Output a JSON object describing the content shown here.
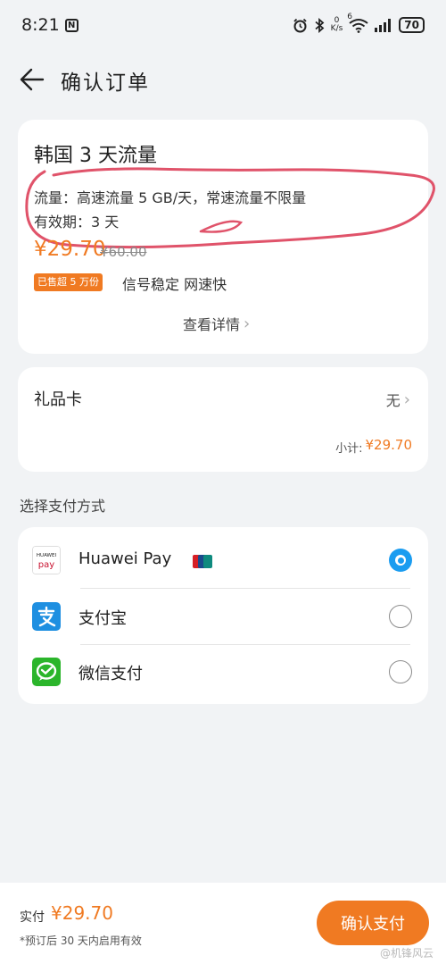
{
  "status_bar": {
    "time": "8:21",
    "notification_badge": "N",
    "network_speed_value": "0",
    "network_speed_unit": "K/s",
    "wifi_label": "6",
    "battery": "70"
  },
  "header": {
    "title": "确认订单"
  },
  "product": {
    "name": "韩国 3 天流量",
    "spec_traffic": "流量：高速流量 5 GB/天，常速流量不限量",
    "spec_validity": "有效期：3 天",
    "price": "¥29.70",
    "original_price": "¥60.00",
    "sold_badge": "已售超 5 万份",
    "tagline": "信号稳定 网速快",
    "details_link": "查看详情"
  },
  "gift_card": {
    "label": "礼品卡",
    "value": "无",
    "subtotal_label": "小计:",
    "subtotal_amount": "¥29.70"
  },
  "payment": {
    "section_title": "选择支付方式",
    "methods": [
      {
        "name": "Huawei Pay",
        "icon": "huawei-pay-icon",
        "selected": true
      },
      {
        "name": "支付宝",
        "icon": "alipay-icon",
        "selected": false
      },
      {
        "name": "微信支付",
        "icon": "wechat-pay-icon",
        "selected": false
      }
    ]
  },
  "bottom": {
    "total_label": "实付",
    "total_amount": "¥29.70",
    "validity_note": "*预订后 30 天内启用有效",
    "confirm_label": "确认支付",
    "watermark": "@机锋风云"
  },
  "colors": {
    "accent": "#f07a22",
    "radio_selected": "#1a9cf0",
    "annotation_stroke": "#e0536a"
  }
}
